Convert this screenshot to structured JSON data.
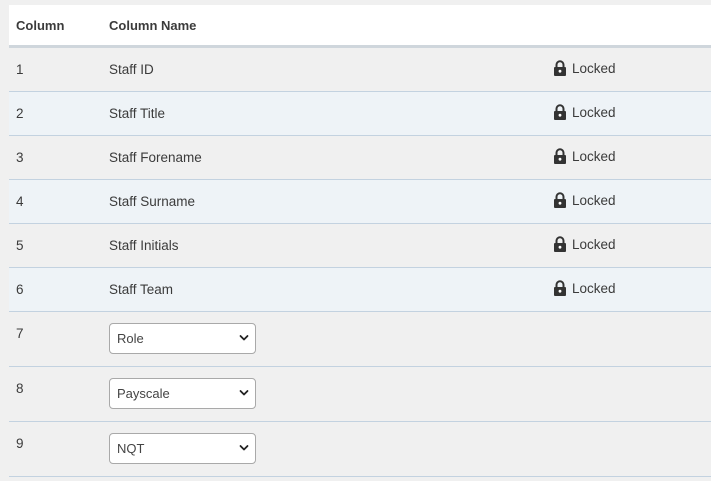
{
  "table": {
    "headers": {
      "column": "Column",
      "column_name": "Column Name",
      "status": ""
    },
    "locked_rows": [
      {
        "num": "1",
        "name": "Staff ID",
        "status": "Locked"
      },
      {
        "num": "2",
        "name": "Staff Title",
        "status": "Locked"
      },
      {
        "num": "3",
        "name": "Staff Forename",
        "status": "Locked"
      },
      {
        "num": "4",
        "name": "Staff Surname",
        "status": "Locked"
      },
      {
        "num": "5",
        "name": "Staff Initials",
        "status": "Locked"
      },
      {
        "num": "6",
        "name": "Staff Team",
        "status": "Locked"
      }
    ],
    "select_rows": [
      {
        "num": "7",
        "selected": "Role"
      },
      {
        "num": "8",
        "selected": "Payscale"
      },
      {
        "num": "9",
        "selected": "NQT"
      }
    ]
  },
  "icons": {
    "lock": "lock-icon",
    "dropdown": "chevron-down-icon"
  },
  "colors": {
    "row_border": "#c3d2e0",
    "header_border": "#cfd6dc",
    "alt_row": "#eef3f7",
    "background": "#f0f0f0"
  }
}
